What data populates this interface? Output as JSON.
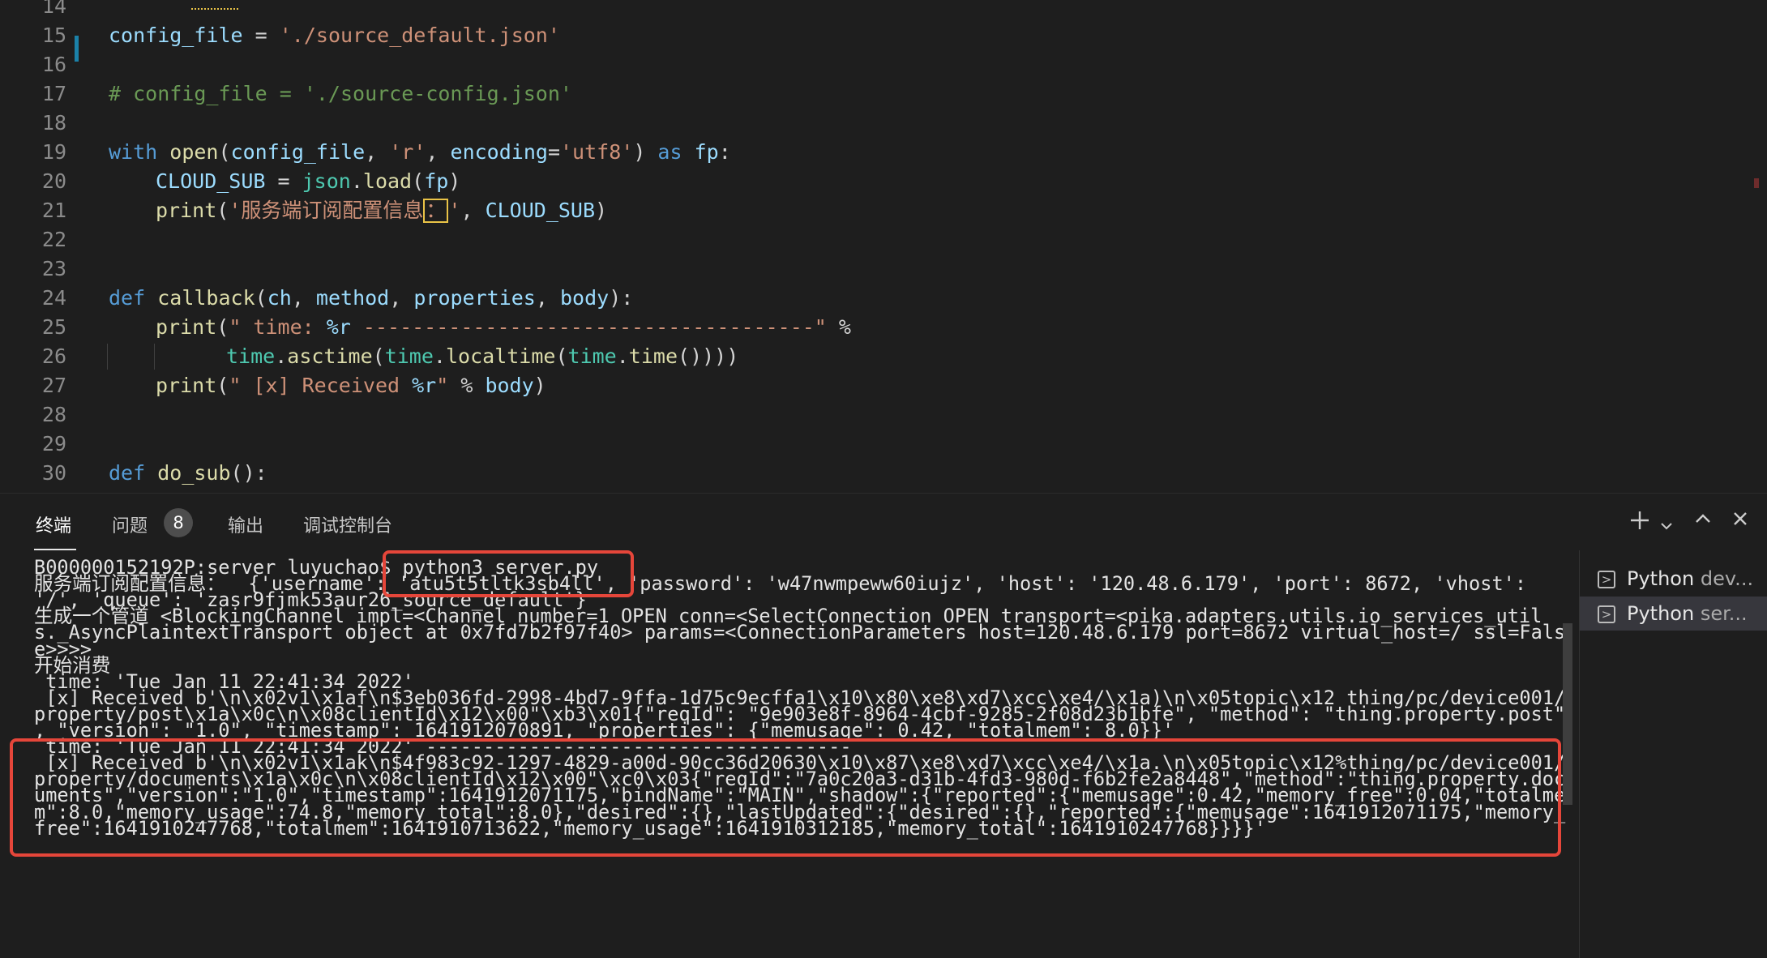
{
  "editor": {
    "lines": [
      {
        "num": "14"
      },
      {
        "num": "15",
        "tokens": [
          {
            "t": "config_file",
            "c": "var"
          },
          {
            "t": " = ",
            "c": ""
          },
          {
            "t": "'./source_default.json'",
            "c": "str"
          }
        ]
      },
      {
        "num": "16"
      },
      {
        "num": "17",
        "tokens": [
          {
            "t": "# config_file = './source-config.json'",
            "c": "com"
          }
        ]
      },
      {
        "num": "18"
      },
      {
        "num": "19",
        "tokens": [
          {
            "t": "with",
            "c": "kw"
          },
          {
            "t": " ",
            "c": ""
          },
          {
            "t": "open",
            "c": "fn"
          },
          {
            "t": "(",
            "c": ""
          },
          {
            "t": "config_file",
            "c": "var"
          },
          {
            "t": ", ",
            "c": ""
          },
          {
            "t": "'r'",
            "c": "str"
          },
          {
            "t": ", ",
            "c": ""
          },
          {
            "t": "encoding",
            "c": "var"
          },
          {
            "t": "=",
            "c": ""
          },
          {
            "t": "'utf8'",
            "c": "str"
          },
          {
            "t": ") ",
            "c": ""
          },
          {
            "t": "as",
            "c": "kw"
          },
          {
            "t": " ",
            "c": ""
          },
          {
            "t": "fp",
            "c": "var"
          },
          {
            "t": ":",
            "c": ""
          }
        ]
      },
      {
        "num": "20",
        "indent": 1,
        "tokens": [
          {
            "t": "CLOUD_SUB",
            "c": "var"
          },
          {
            "t": " = ",
            "c": ""
          },
          {
            "t": "json",
            "c": "teal"
          },
          {
            "t": ".",
            "c": ""
          },
          {
            "t": "load",
            "c": "fn"
          },
          {
            "t": "(",
            "c": ""
          },
          {
            "t": "fp",
            "c": "var"
          },
          {
            "t": ")",
            "c": ""
          }
        ]
      },
      {
        "num": "21",
        "indent": 1,
        "tokens": [
          {
            "t": "print",
            "c": "fn"
          },
          {
            "t": "(",
            "c": ""
          },
          {
            "t": "'服务端订阅配置信息",
            "c": "str"
          },
          {
            "t": "：",
            "c": "warn"
          },
          {
            "t": "'",
            "c": "str"
          },
          {
            "t": ", ",
            "c": ""
          },
          {
            "t": "CLOUD_SUB",
            "c": "var"
          },
          {
            "t": ")",
            "c": ""
          }
        ]
      },
      {
        "num": "22"
      },
      {
        "num": "23"
      },
      {
        "num": "24",
        "tokens": [
          {
            "t": "def",
            "c": "kw"
          },
          {
            "t": " ",
            "c": ""
          },
          {
            "t": "callback",
            "c": "fn"
          },
          {
            "t": "(",
            "c": ""
          },
          {
            "t": "ch",
            "c": "var"
          },
          {
            "t": ", ",
            "c": ""
          },
          {
            "t": "method",
            "c": "var"
          },
          {
            "t": ", ",
            "c": ""
          },
          {
            "t": "properties",
            "c": "var"
          },
          {
            "t": ", ",
            "c": ""
          },
          {
            "t": "body",
            "c": "var"
          },
          {
            "t": "):",
            "c": ""
          }
        ]
      },
      {
        "num": "25",
        "indent": 1,
        "tokens": [
          {
            "t": "print",
            "c": "fn"
          },
          {
            "t": "(",
            "c": ""
          },
          {
            "t": "\" time: ",
            "c": "str"
          },
          {
            "t": "%r",
            "c": "var"
          },
          {
            "t": " -------------------------------------\"",
            "c": "str"
          },
          {
            "t": " %",
            "c": ""
          }
        ]
      },
      {
        "num": "26",
        "indent": 2,
        "tokens": [
          {
            "t": "time",
            "c": "teal"
          },
          {
            "t": ".",
            "c": ""
          },
          {
            "t": "asctime",
            "c": "fn"
          },
          {
            "t": "(",
            "c": ""
          },
          {
            "t": "time",
            "c": "teal"
          },
          {
            "t": ".",
            "c": ""
          },
          {
            "t": "localtime",
            "c": "fn"
          },
          {
            "t": "(",
            "c": ""
          },
          {
            "t": "time",
            "c": "teal"
          },
          {
            "t": ".",
            "c": ""
          },
          {
            "t": "time",
            "c": "fn"
          },
          {
            "t": "()))) ",
            "c": ""
          }
        ]
      },
      {
        "num": "27",
        "indent": 1,
        "tokens": [
          {
            "t": "print",
            "c": "fn"
          },
          {
            "t": "(",
            "c": ""
          },
          {
            "t": "\" [x] Received ",
            "c": "str"
          },
          {
            "t": "%r",
            "c": "var"
          },
          {
            "t": "\"",
            "c": "str"
          },
          {
            "t": " % ",
            "c": ""
          },
          {
            "t": "body",
            "c": "var"
          },
          {
            "t": ")",
            "c": ""
          }
        ]
      },
      {
        "num": "28"
      },
      {
        "num": "29"
      },
      {
        "num": "30",
        "tokens": [
          {
            "t": "def",
            "c": "kw"
          },
          {
            "t": " ",
            "c": ""
          },
          {
            "t": "do_sub",
            "c": "fn"
          },
          {
            "t": "():",
            "c": ""
          }
        ]
      }
    ]
  },
  "panel": {
    "tabs": {
      "terminal": "终端",
      "problems": "问题",
      "problems_count": "8",
      "output": "输出",
      "debug_console": "调试控制台"
    },
    "terminal_lines": [
      "B000000152192P:server luyuchao$ python3 server.py",
      "服务端订阅配置信息：  {'username': 'atu5t5tltk3sb4ll', 'password': 'w47nwmpeww60iujz', 'host': '120.48.6.179', 'port': 8672, 'vhost':",
      "'/', 'queue': 'zasr9fjmk53aur26_source_default'}",
      "生成一个管道 <BlockingChannel impl=<Channel number=1 OPEN conn=<SelectConnection OPEN transport=<pika.adapters.utils.io_services_util",
      "s._AsyncPlaintextTransport object at 0x7fd7b2f97f40> params=<ConnectionParameters host=120.48.6.179 port=8672 virtual_host=/ ssl=Fals",
      "e>>>>",
      "开始消费",
      " time: 'Tue Jan 11 22:41:34 2022'",
      " [x] Received b'\\n\\x02v1\\x1af\\n$3eb036fd-2998-4bd7-9ffa-1d75c9ecffa1\\x10\\x80\\xe8\\xd7\\xcc\\xe4/\\x1a)\\n\\x05topic\\x12 thing/pc/device001/",
      "property/post\\x1a\\x0c\\n\\x08clientId\\x12\\x00\"\\xb3\\x01{\"reqId\": \"9e903e8f-8964-4cbf-9285-2f08d23b1bfe\", \"method\": \"thing.property.post\"",
      ", \"version\": \"1.0\", \"timestamp\": 1641912070891, \"properties\": {\"memusage\": 0.42, \"totalmem\": 8.0}}'",
      " time: 'Tue Jan 11 22:41:34 2022' -------------------------------------",
      " [x] Received b'\\n\\x02v1\\x1ak\\n$4f983c92-1297-4829-a00d-90cc36d20630\\x10\\x87\\xe8\\xd7\\xcc\\xe4/\\x1a.\\n\\x05topic\\x12%thing/pc/device001/",
      "property/documents\\x1a\\x0c\\n\\x08clientId\\x12\\x00\"\\xc0\\x03{\"reqId\":\"7a0c20a3-d31b-4fd3-980d-f6b2fe2a8448\",\"method\":\"thing.property.doc",
      "uments\",\"version\":\"1.0\",\"timestamp\":1641912071175,\"bindName\":\"MAIN\",\"shadow\":{\"reported\":{\"memusage\":0.42,\"memory_free\":0.04,\"totalme",
      "m\":8.0,\"memory_usage\":74.8,\"memory_total\":8.0},\"desired\":{},\"lastUpdated\":{\"desired\":{},\"reported\":{\"memusage\":1641912071175,\"memory_",
      "free\":1641910247768,\"totalmem\":1641910713622,\"memory_usage\":1641910312185,\"memory_total\":1641910247768}}}}'"
    ],
    "terminal_list": [
      {
        "name": "Python",
        "sub": "dev..."
      },
      {
        "name": "Python",
        "sub": "ser..."
      }
    ],
    "icons": {
      "add": "plus-icon",
      "dropdown": "chevron-down-icon",
      "maximize": "chevron-up-icon",
      "close": "close-icon"
    }
  }
}
